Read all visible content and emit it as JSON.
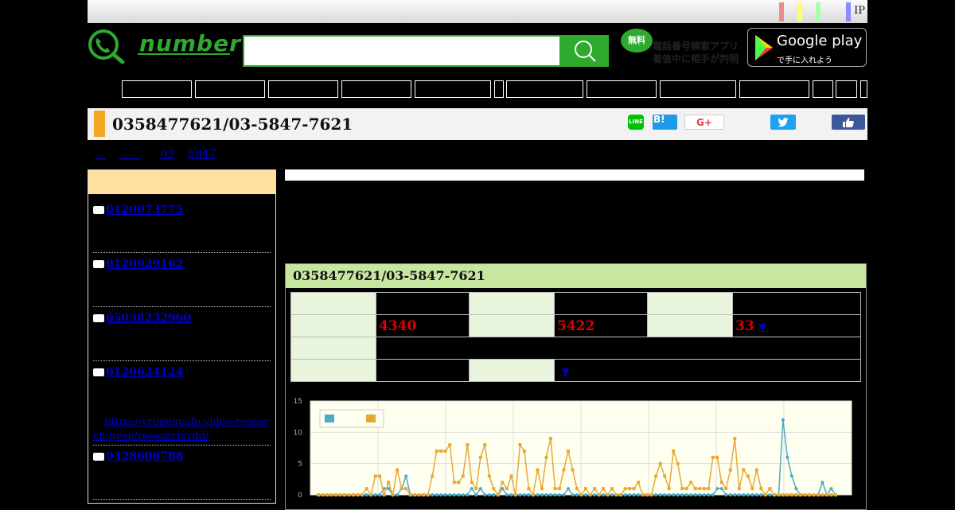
{
  "header": {
    "ip_label": "IP",
    "logo_text": "number",
    "search": {
      "placeholder": "",
      "value": ""
    },
    "app_badge": "無料",
    "app_text_line1": "電話番号検索アプリ",
    "app_text_line2": "着信中に相手が判明",
    "google_play_title": "Google play",
    "google_play_sub": "で手に入れよう",
    "stripe_colors": [
      "#f08a8a",
      "#ffff66",
      "#aaffaa",
      "#8a8aff"
    ]
  },
  "page": {
    "title": "0358477621/03-5847-7621"
  },
  "share": {
    "line": "LINE",
    "hatena": "B!",
    "gplus": "G+"
  },
  "breadcrumb": [
    "__",
    "____",
    "03",
    "5847"
  ],
  "sidebar": {
    "items": [
      {
        "number": "0120073775"
      },
      {
        "number": "0120929162"
      },
      {
        "number": "05038232960"
      },
      {
        "number": "0120624124"
      },
      {
        "number": "0428606788"
      }
    ],
    "link": "https://vrupencafe.video-research.jp/sp/research/rdd/"
  },
  "panel": {
    "title": "0358477621/03-5847-7621",
    "stat1": "4340",
    "stat2": "5422",
    "stat3": "33",
    "arrow": "▼"
  },
  "chart_data": {
    "type": "line",
    "ylim": [
      0,
      15
    ],
    "yticks": [
      0,
      5,
      10,
      15
    ],
    "series": [
      {
        "color": "#4aaac8",
        "values": [
          0,
          0,
          0,
          0,
          0,
          0,
          0,
          0,
          0,
          0,
          0,
          0,
          0,
          0,
          0,
          1,
          1,
          0,
          0,
          1,
          3,
          0,
          0,
          0,
          0,
          0,
          0,
          0,
          0,
          0,
          0,
          0,
          0,
          0,
          0,
          1,
          0,
          1,
          0,
          0,
          0,
          0,
          1,
          0,
          0,
          0,
          0,
          0,
          0,
          0,
          0,
          0,
          0,
          0,
          0,
          0,
          0,
          1,
          0,
          0,
          0,
          0,
          0,
          0,
          0,
          0,
          0,
          0,
          0,
          0,
          0,
          0,
          0,
          0,
          0,
          0,
          0,
          0,
          0,
          0,
          0,
          0,
          0,
          0,
          0,
          0,
          0,
          0,
          0,
          0,
          0,
          1,
          1,
          0,
          0,
          0,
          0,
          0,
          0,
          0,
          0,
          0,
          0,
          0,
          0,
          0,
          12,
          6,
          3,
          1,
          0,
          0,
          0,
          0,
          0,
          2,
          0,
          1,
          0
        ]
      },
      {
        "color": "#e8a838",
        "values": [
          0,
          0,
          0,
          0,
          0,
          0,
          0,
          0,
          0,
          0,
          0,
          1,
          0,
          3,
          3,
          0,
          2,
          0,
          4,
          1,
          1,
          0,
          0,
          0,
          0,
          0,
          3,
          7,
          7,
          7,
          8,
          2,
          2,
          3,
          8,
          2,
          1,
          6,
          8,
          3,
          1,
          0,
          2,
          1,
          3,
          0,
          8,
          7,
          1,
          0,
          4,
          1,
          6,
          9,
          1,
          1,
          4,
          7,
          4,
          1,
          0,
          1,
          0,
          1,
          0,
          1,
          0,
          1,
          0,
          0,
          1,
          1,
          1,
          2,
          0,
          0,
          0,
          3,
          5,
          3,
          1,
          7,
          5,
          1,
          1,
          2,
          1,
          1,
          1,
          1,
          6,
          6,
          2,
          1,
          4,
          9,
          1,
          4,
          3,
          1,
          4,
          1,
          0,
          1,
          0,
          0,
          0,
          0,
          0,
          0,
          0,
          0,
          0,
          0,
          0,
          0,
          0,
          0,
          0
        ]
      }
    ]
  }
}
